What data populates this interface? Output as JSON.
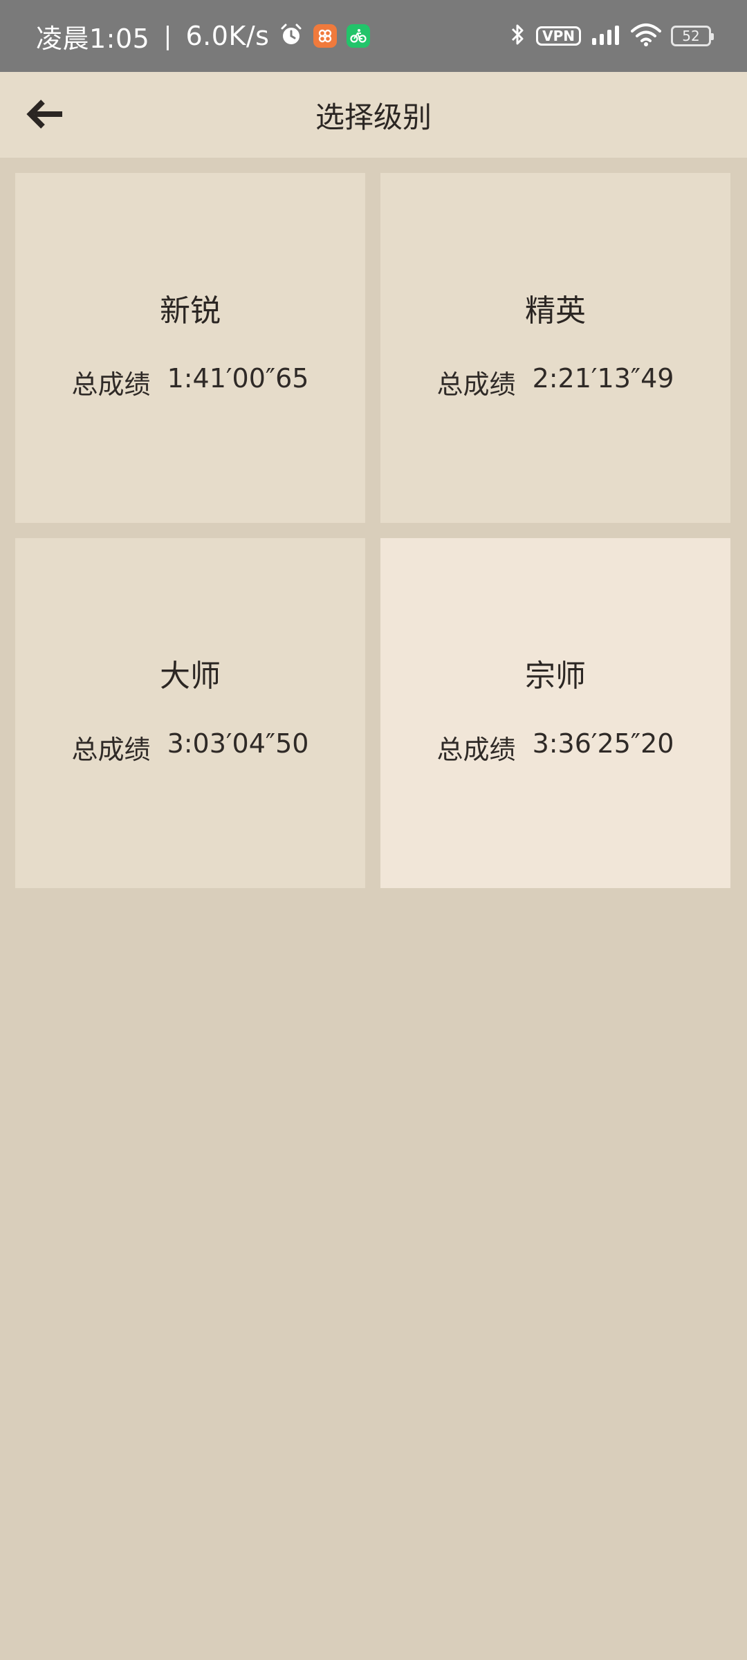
{
  "status_bar": {
    "time": "凌晨1:05",
    "separator": "|",
    "net_speed": "6.0K/s",
    "vpn": "VPN",
    "battery": "52"
  },
  "header": {
    "title": "选择级别"
  },
  "levels": [
    {
      "name": "新锐",
      "score_label": "总成绩",
      "score": "1:41′00″65"
    },
    {
      "name": "精英",
      "score_label": "总成绩",
      "score": "2:21′13″49"
    },
    {
      "name": "大师",
      "score_label": "总成绩",
      "score": "3:03′04″50"
    },
    {
      "name": "宗师",
      "score_label": "总成绩",
      "score": "3:36′25″20"
    }
  ],
  "colors": {
    "status_bar": "#7a7a7a",
    "app_bar": "#e6dcca",
    "background": "#d9cebb",
    "card": "#e6dcca",
    "card_selected": "#f1e6d8"
  },
  "icons": [
    "alarm-icon",
    "app-orange-icon",
    "app-green-bike-icon",
    "bluetooth-icon",
    "signal-icon",
    "wifi-icon",
    "battery-icon",
    "back-arrow-icon"
  ]
}
